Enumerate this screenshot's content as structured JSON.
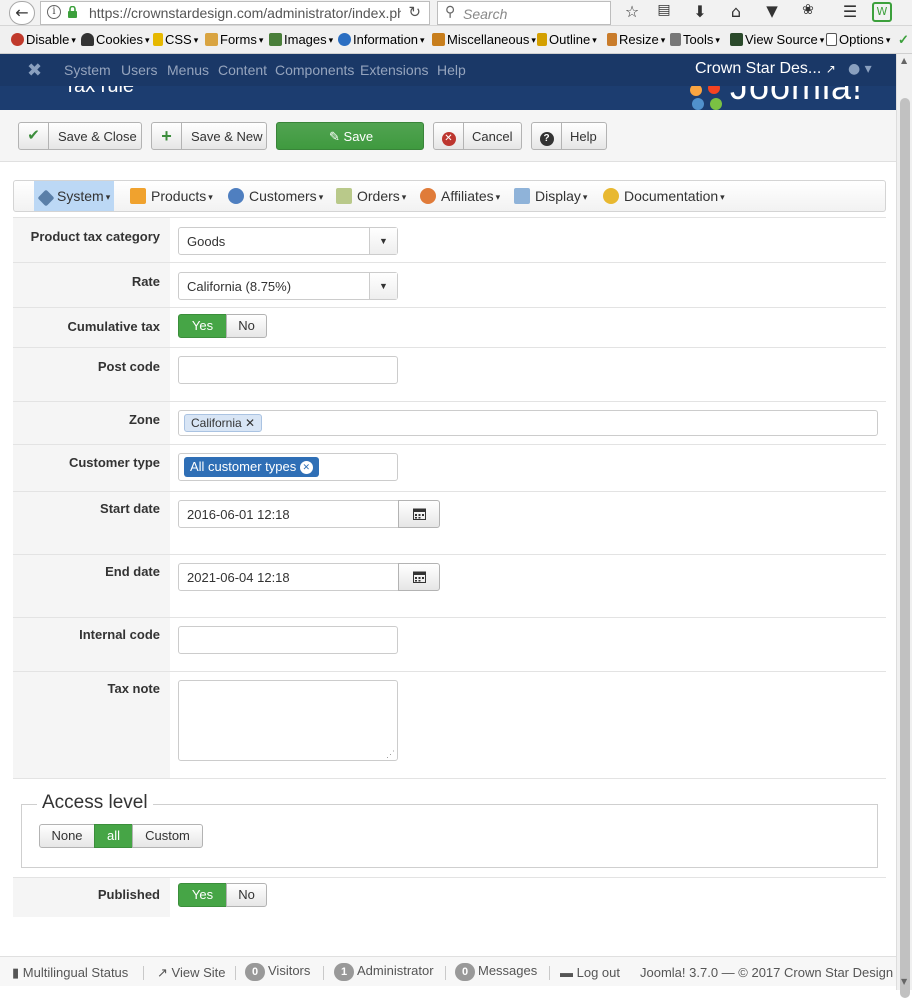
{
  "browser": {
    "url": "https://crownstardesign.com/administrator/index.php?option=com_virtuemart",
    "search_placeholder": "Search"
  },
  "webdev_toolbar": {
    "items": [
      "Disable",
      "Cookies",
      "CSS",
      "Forms",
      "Images",
      "Information",
      "Miscellaneous",
      "Outline",
      "Resize",
      "Tools",
      "View Source",
      "Options"
    ]
  },
  "admin_nav": {
    "menus": [
      "System",
      "Users",
      "Menus",
      "Content",
      "Components",
      "Extensions",
      "Help"
    ],
    "site_name": "Crown Star Des..."
  },
  "header": {
    "page_title": "Tax rule",
    "logo_text": "Joomla!"
  },
  "toolbar": {
    "save_close": "Save & Close",
    "save_new": "Save & New",
    "save": "Save",
    "cancel": "Cancel",
    "help": "Help"
  },
  "component_menu": {
    "items": [
      "System",
      "Products",
      "Customers",
      "Orders",
      "Affiliates",
      "Display",
      "Documentation"
    ]
  },
  "form": {
    "product_tax_category": {
      "label": "Product tax category",
      "value": "Goods"
    },
    "rate": {
      "label": "Rate",
      "value": "California (8.75%)"
    },
    "cumulative_tax": {
      "label": "Cumulative tax",
      "yes": "Yes",
      "no": "No",
      "selected": "Yes"
    },
    "post_code": {
      "label": "Post code",
      "value": ""
    },
    "zone": {
      "label": "Zone",
      "chip": "California"
    },
    "customer_type": {
      "label": "Customer type",
      "chip": "All customer types"
    },
    "start_date": {
      "label": "Start date",
      "value": "2016-06-01 12:18"
    },
    "end_date": {
      "label": "End date",
      "value": "2021-06-04 12:18"
    },
    "internal_code": {
      "label": "Internal code",
      "value": ""
    },
    "tax_note": {
      "label": "Tax note",
      "value": ""
    },
    "access_level": {
      "legend": "Access level",
      "options": [
        "None",
        "all",
        "Custom"
      ],
      "selected": "all"
    },
    "published": {
      "label": "Published",
      "yes": "Yes",
      "no": "No",
      "selected": "Yes"
    }
  },
  "statusbar": {
    "multilingual": "Multilingual Status",
    "view_site": "View Site",
    "visitors_count": "0",
    "visitors": "Visitors",
    "admin_count": "1",
    "administrator": "Administrator",
    "messages_count": "0",
    "messages": "Messages",
    "logout": "Log out",
    "version": "Joomla! 3.7.0  —  © 2017 Crown Star Design"
  },
  "colors": {
    "admin_nav": "#1a3867",
    "save_green": "#46a546",
    "chip_blue": "#2f6fb6",
    "chip_light": "#d8e5f5"
  }
}
